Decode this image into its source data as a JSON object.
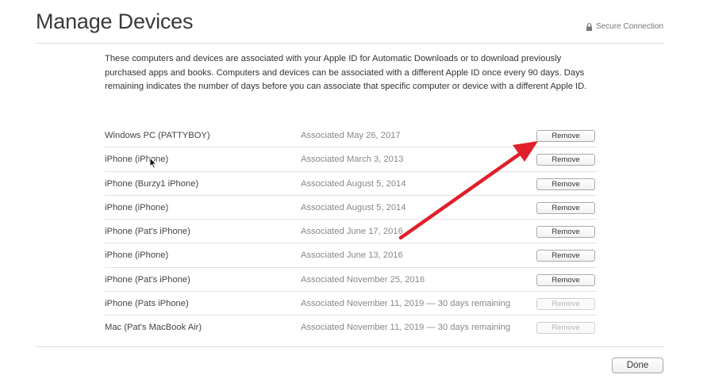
{
  "header": {
    "title": "Manage Devices",
    "secure_label": "Secure Connection",
    "secure_icon": "lock-icon"
  },
  "description": "These computers and devices are associated with your Apple ID for Automatic Downloads or to download previously purchased apps and books. Computers and devices can be associated with a different Apple ID once every 90 days. Days remaining indicates the number of days before you can associate that specific computer or device with a different Apple ID.",
  "devices": [
    {
      "name": "Windows PC (PATTYBOY)",
      "date": "Associated May 26, 2017",
      "remove_label": "Remove",
      "remove_enabled": true
    },
    {
      "name": "iPhone (iPhone)",
      "date": "Associated March 3, 2013",
      "remove_label": "Remove",
      "remove_enabled": true
    },
    {
      "name": "iPhone (Burzy1 iPhone)",
      "date": "Associated August 5, 2014",
      "remove_label": "Remove",
      "remove_enabled": true
    },
    {
      "name": "iPhone (iPhone)",
      "date": "Associated August 5, 2014",
      "remove_label": "Remove",
      "remove_enabled": true
    },
    {
      "name": "iPhone (Pat's iPhone)",
      "date": "Associated June 17, 2016",
      "remove_label": "Remove",
      "remove_enabled": true
    },
    {
      "name": "iPhone (iPhone)",
      "date": "Associated June 13, 2016",
      "remove_label": "Remove",
      "remove_enabled": true
    },
    {
      "name": "iPhone (Pat's iPhone)",
      "date": "Associated November 25, 2016",
      "remove_label": "Remove",
      "remove_enabled": true
    },
    {
      "name": "iPhone (Pats iPhone)",
      "date": "Associated November 11, 2019 — 30 days remaining",
      "remove_label": "Remove",
      "remove_enabled": false
    },
    {
      "name": "Mac (Pat's MacBook Air)",
      "date": "Associated November 11, 2019 — 30 days remaining",
      "remove_label": "Remove",
      "remove_enabled": false
    }
  ],
  "footer": {
    "done_label": "Done"
  },
  "colors": {
    "annotation_arrow": "#e0202a",
    "disabled_text": "#b8b8b8"
  }
}
